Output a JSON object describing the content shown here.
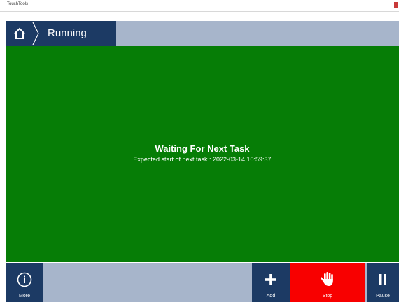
{
  "window": {
    "title": "TouchTools"
  },
  "header": {
    "home_icon": "home-icon",
    "breadcrumb": "Running"
  },
  "status": {
    "title": "Waiting For Next Task",
    "subtitle": "Expected start of next task : 2022-03-14 10:59:37"
  },
  "footer": {
    "more_label": "More",
    "add_label": "Add",
    "stop_label": "Stop",
    "pause_label": "Pause"
  },
  "colors": {
    "nav_dark": "#1c3a64",
    "bar_light": "#a7b5cb",
    "status_green": "#067d06",
    "stop_red": "#f80000"
  }
}
